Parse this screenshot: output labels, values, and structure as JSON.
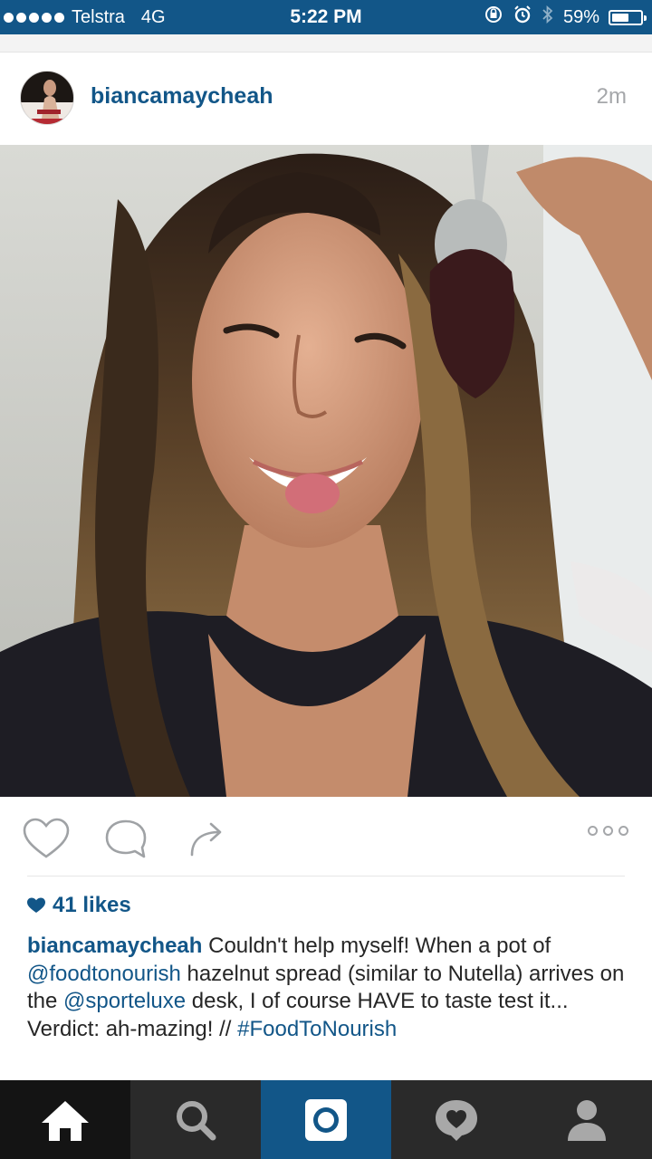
{
  "status_bar": {
    "carrier": "Telstra",
    "network": "4G",
    "time": "5:22 PM",
    "battery_percent": "59%",
    "battery_level": 0.59
  },
  "post": {
    "username": "biancamaycheah",
    "timestamp": "2m",
    "likes": "41 likes",
    "caption": {
      "user": "biancamaycheah",
      "part1": " Couldn't help myself! When a pot of ",
      "mention1": "@foodtonourish",
      "part2": " hazelnut spread (similar to Nutella) arrives on the ",
      "mention2": "@sporteluxe",
      "part3": " desk, I of course HAVE to taste test it... Verdict: ah-mazing! // ",
      "hashtag": "#FoodToNourish"
    }
  },
  "colors": {
    "brand_blue": "#125688",
    "muted_gray": "#a5a7aa",
    "tab_bar": "#2a2a2a"
  },
  "icons": {
    "like": "heart-outline-icon",
    "comment": "comment-bubble-icon",
    "share": "share-arrow-icon",
    "more": "more-dots-icon",
    "home": "home-icon",
    "search": "search-icon",
    "camera": "camera-icon",
    "activity": "activity-heart-icon",
    "profile": "profile-icon"
  }
}
